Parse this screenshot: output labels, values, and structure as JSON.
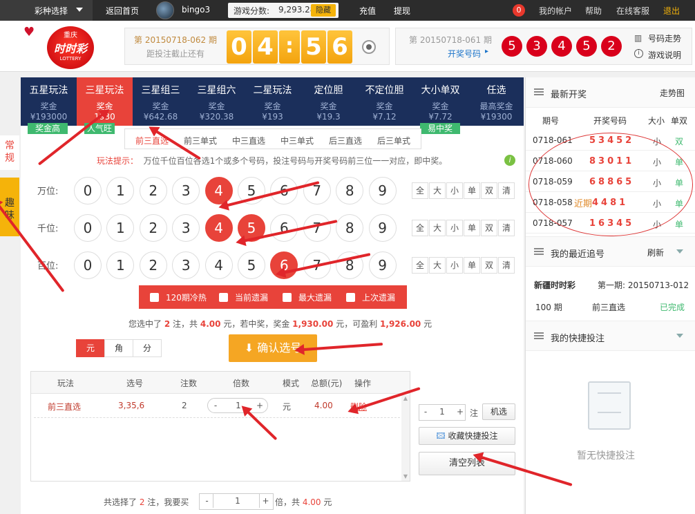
{
  "topbar": {
    "game_select": "彩种选择",
    "home": "返回首页",
    "username": "bingo3",
    "score_label": "游戏分数:",
    "score_value": "9,293.28",
    "hide": "隐藏",
    "recharge": "充值",
    "withdraw": "提现",
    "msg_count": "0",
    "account": "我的帐户",
    "help": "帮助",
    "service": "在线客服",
    "logout": "退出"
  },
  "header": {
    "logo_top": "重庆",
    "logo_main": "时时彩",
    "logo_sub": "LOTTERY",
    "current_issue": "第 20150718-062 期",
    "deadline_text": "距投注截止还有",
    "countdown": [
      "0",
      "4",
      ":",
      "5",
      "6"
    ],
    "last_issue": "第 20150718-061 期",
    "draw_label": "开奖号码",
    "last_balls": [
      "5",
      "3",
      "4",
      "5",
      "2"
    ],
    "trend": "号码走势",
    "rules": "游戏说明"
  },
  "sidetabs": {
    "normal": "常规",
    "fun": "趣味"
  },
  "nav": {
    "bonus_label": "奖金",
    "items": [
      {
        "name": "五星玩法",
        "label": "奖金",
        "value": "¥193000"
      },
      {
        "name": "三星玩法",
        "label": "奖金",
        "value": "1930"
      },
      {
        "name": "三星组三",
        "label": "奖金",
        "value": "¥642.68"
      },
      {
        "name": "三星组六",
        "label": "奖金",
        "value": "¥320.38"
      },
      {
        "name": "二星玩法",
        "label": "奖金",
        "value": "¥193"
      },
      {
        "name": "定位胆",
        "label": "奖金",
        "value": "¥19.3"
      },
      {
        "name": "不定位胆",
        "label": "奖金",
        "value": "¥7.12"
      },
      {
        "name": "大小单双",
        "label": "奖金",
        "value": "¥7.72"
      },
      {
        "name": "任选",
        "label": "最高奖金",
        "value": "¥19300"
      }
    ],
    "tags": [
      "奖金高",
      "人气旺",
      "易中奖"
    ]
  },
  "subnav": [
    "前三直选",
    "前三单式",
    "中三直选",
    "中三单式",
    "后三直选",
    "后三单式"
  ],
  "tip": {
    "label": "玩法提示：",
    "text": "万位千位百位各选1个或多个号码，投注号码与开奖号码前三位一一对应，即中奖。"
  },
  "rows": [
    {
      "label": "万位:"
    },
    {
      "label": "千位:"
    },
    {
      "label": "百位:"
    }
  ],
  "digits": [
    "0",
    "1",
    "2",
    "3",
    "4",
    "5",
    "6",
    "7",
    "8",
    "9"
  ],
  "filters": [
    "全",
    "大",
    "小",
    "单",
    "双",
    "清"
  ],
  "statbar": [
    "120期冷热",
    "当前遗漏",
    "最大遗漏",
    "上次遗漏"
  ],
  "summary": {
    "p1": "您选中了",
    "count": "2",
    "p2": "注，共",
    "amount": "4.00",
    "p3": "元，若中奖，奖金",
    "prize": "1,930.00",
    "p4": "元，可盈利",
    "profit": "1,926.00",
    "p5": "元"
  },
  "units": [
    "元",
    "角",
    "分"
  ],
  "confirm": "确认选号",
  "table": {
    "headers": [
      "玩法",
      "选号",
      "注数",
      "倍数",
      "模式",
      "总额(元)",
      "操作"
    ],
    "row": {
      "play": "前三直选",
      "nums": "3,35,6",
      "count": "2",
      "multiple": "1",
      "mode": "元",
      "total": "4.00",
      "action": "删除"
    }
  },
  "side": {
    "bets": "1",
    "bets_unit": "注",
    "random": "机选",
    "save": "收藏快捷投注",
    "clear": "清空列表"
  },
  "bottom": {
    "p1": "共选择了",
    "count": "2",
    "p2": "注，我要买",
    "multiple": "1",
    "p3": "倍，共",
    "total": "4.00",
    "p4": "元"
  },
  "right": {
    "latest_title": "最新开奖",
    "trend_link": "走势图",
    "cols": [
      "期号",
      "开奖号码",
      "大小",
      "单双"
    ],
    "draws": [
      {
        "issue": "0718-061",
        "nums": "53452",
        "size": "小",
        "parity": "双"
      },
      {
        "issue": "0718-060",
        "nums": "83011",
        "size": "小",
        "parity": "单"
      },
      {
        "issue": "0718-059",
        "nums": "68865",
        "size": "小",
        "parity": "单"
      },
      {
        "issue": "0718-058",
        "nums": "4481",
        "size": "小",
        "parity": "单"
      },
      {
        "issue": "0718-057",
        "nums": "16345",
        "size": "小",
        "parity": "单"
      }
    ],
    "annotation": "近期",
    "chase_title": "我的最近追号",
    "refresh": "刷新",
    "chase": {
      "lottery": "新疆时时彩",
      "first": "第一期: 20150713-012",
      "periods": "100 期",
      "play": "前三直选",
      "status": "已完成"
    },
    "quick_title": "我的快捷投注",
    "empty": "暂无快捷投注"
  },
  "colors": {
    "red": "#e8433a",
    "nav": "#1b2f5b",
    "orange": "#f5a623",
    "green": "#3fb96f"
  }
}
